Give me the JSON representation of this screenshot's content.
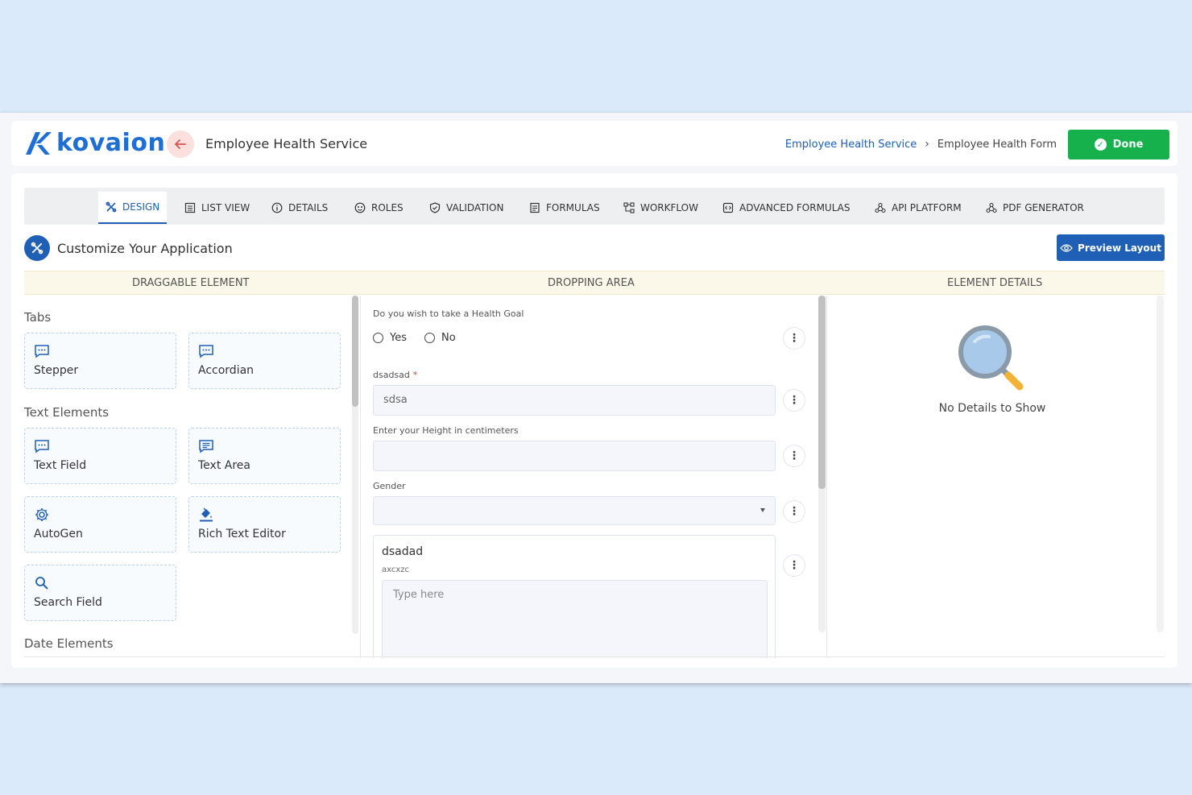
{
  "brand": {
    "name": "kovaion",
    "color": "#1f6ed4"
  },
  "header": {
    "app_title": "Employee Health Service",
    "breadcrumb": {
      "link": "Employee Health Service",
      "current": "Employee Health Form"
    },
    "done_label": "Done"
  },
  "tabs": [
    {
      "label": "DESIGN",
      "icon": "design-icon",
      "active": true
    },
    {
      "label": "LIST VIEW",
      "icon": "list-icon"
    },
    {
      "label": "DETAILS",
      "icon": "info-icon"
    },
    {
      "label": "ROLES",
      "icon": "roles-icon"
    },
    {
      "label": "VALIDATION",
      "icon": "shield-check-icon"
    },
    {
      "label": "FORMULAS",
      "icon": "document-icon"
    },
    {
      "label": "WORKFLOW",
      "icon": "workflow-icon"
    },
    {
      "label": "ADVANCED FORMULAS",
      "icon": "code-icon"
    },
    {
      "label": "API PLATFORM",
      "icon": "webhook-icon"
    },
    {
      "label": "PDF GENERATOR",
      "icon": "webhook-icon"
    }
  ],
  "customize": {
    "title": "Customize Your Application",
    "preview_label": "Preview Layout"
  },
  "columns": {
    "left": "DRAGGABLE ELEMENT",
    "middle": "DROPPING AREA",
    "right": "ELEMENT DETAILS"
  },
  "draggable": {
    "tabs_section": "Tabs",
    "text_section": "Text Elements",
    "date_section": "Date Elements",
    "items": [
      {
        "label": "Stepper",
        "icon": "chat-icon"
      },
      {
        "label": "Accordian",
        "icon": "chat-icon"
      },
      {
        "label": "Text Field",
        "icon": "chat-icon"
      },
      {
        "label": "Text Area",
        "icon": "message-lines-icon"
      },
      {
        "label": "AutoGen",
        "icon": "gear-icon"
      },
      {
        "label": "Rich Text Editor",
        "icon": "paint-bucket-icon"
      },
      {
        "label": "Search Field",
        "icon": "search-icon"
      }
    ]
  },
  "form": {
    "health_goal_label": "Do you wish to take a Health Goal",
    "yes_label": "Yes",
    "no_label": "No",
    "dsadsad_label": "dsadsad",
    "required_mark": "*",
    "dsadsad_value": "sdsa",
    "height_label": "Enter your Height in centimeters",
    "height_value": "",
    "gender_label": "Gender",
    "gender_value": "",
    "textarea_title": "dsadad",
    "textarea_sub": "axcxzc",
    "textarea_placeholder": "Type here"
  },
  "details": {
    "empty_text": "No Details to Show"
  },
  "colors": {
    "primary": "#1f5fb5",
    "done": "#16b04c",
    "back": "#fbe0de"
  }
}
